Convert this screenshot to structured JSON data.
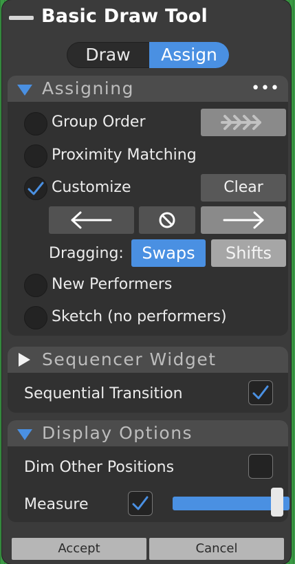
{
  "window": {
    "title": "Basic Draw Tool"
  },
  "mode_toggle": {
    "options": [
      "Draw",
      "Assign"
    ],
    "selected": "Assign"
  },
  "assigning": {
    "title": "Assigning",
    "more_icon": "•••",
    "options": {
      "group_order": {
        "label": "Group Order",
        "selected": false
      },
      "proximity": {
        "label": "Proximity Matching",
        "selected": false
      },
      "customize": {
        "label": "Customize",
        "selected": true
      },
      "new_performers": {
        "label": "New Performers",
        "selected": false
      },
      "sketch": {
        "label": "Sketch (no performers)",
        "selected": false
      }
    },
    "clear_label": "Clear",
    "dragging": {
      "label": "Dragging:",
      "options": [
        "Swaps",
        "Shifts"
      ],
      "selected": "Swaps"
    },
    "icons": {
      "group_order": "chevrons-right-icon",
      "left": "arrow-left-icon",
      "stop": "cancel-icon",
      "right": "arrow-right-icon"
    }
  },
  "sequencer": {
    "title": "Sequencer Widget",
    "sequential_transition": {
      "label": "Sequential Transition",
      "checked": true
    }
  },
  "display_options": {
    "title": "Display Options",
    "dim_other": {
      "label": "Dim Other Positions",
      "checked": false
    },
    "measure": {
      "label": "Measure",
      "checked": true,
      "slider_fraction": 0.96
    }
  },
  "footer": {
    "accept": "Accept",
    "cancel": "Cancel"
  },
  "colors": {
    "accent": "#4a90e2",
    "panel": "#3b3b3b",
    "section_bg": "#313131",
    "header_bg": "#4c4c4c"
  }
}
